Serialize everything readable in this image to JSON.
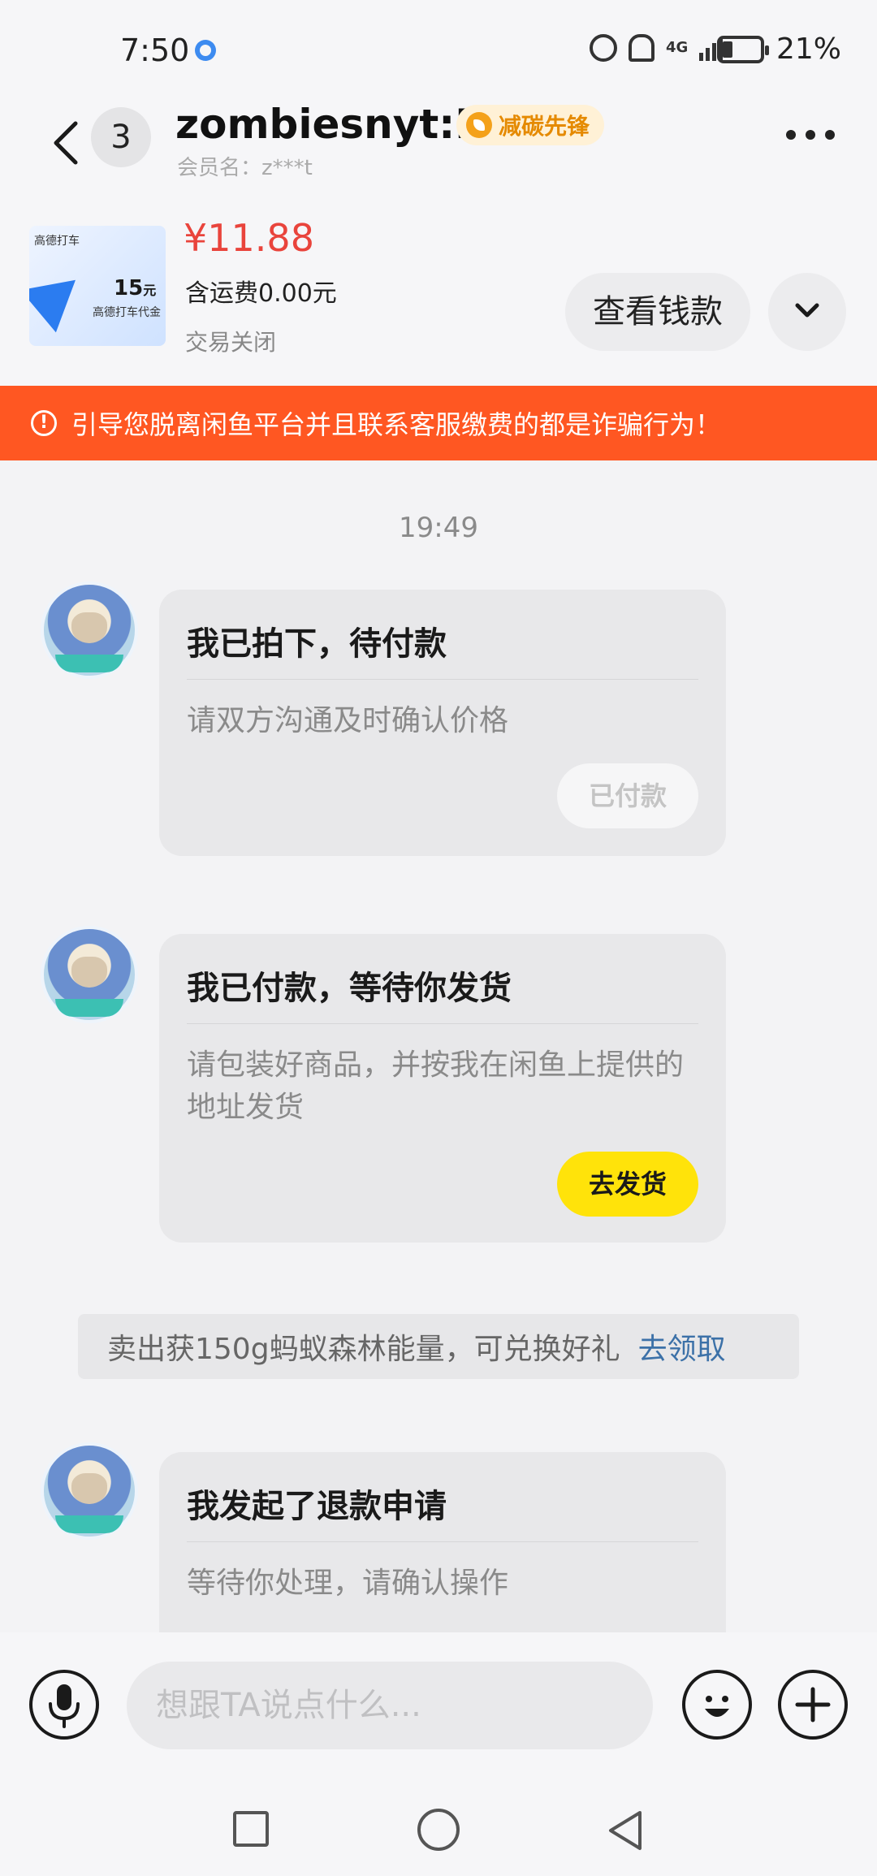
{
  "status_bar": {
    "time": "7:50",
    "battery": "21%",
    "network": "4G"
  },
  "header": {
    "unread_count": "3",
    "name": "zombiesnyt:D",
    "badge": "减碳先锋",
    "member_label": "会员名：z***t"
  },
  "product": {
    "thumb_brand": "高德打车",
    "thumb_value": "15",
    "thumb_unit": "元",
    "thumb_label": "高德打车代金",
    "price": "¥11.88",
    "shipping": "含运费0.00元",
    "status": "交易关闭",
    "view_payment": "查看钱款"
  },
  "warning": "引导您脱离闲鱼平台并且联系客服缴费的都是诈骗行为！",
  "chat": {
    "time": "19:49",
    "messages": [
      {
        "title": "我已拍下，待付款",
        "body": "请双方沟通及时确认价格",
        "button": "已付款"
      },
      {
        "title": "我已付款，等待你发货",
        "body": "请包装好商品，并按我在闲鱼上提供的地址发货",
        "button": "去发货"
      },
      {
        "title": "我发起了退款申请",
        "body": "等待你处理，请确认操作"
      }
    ],
    "reward": {
      "text": "卖出获150g蚂蚁森林能量，可兑换好礼",
      "link": "去领取"
    }
  },
  "input": {
    "placeholder": "想跟TA说点什么..."
  },
  "colors": {
    "price": "#e9443c",
    "warning_bg": "#ff5722",
    "ship_button": "#ffe30a",
    "link": "#3c71a8"
  }
}
